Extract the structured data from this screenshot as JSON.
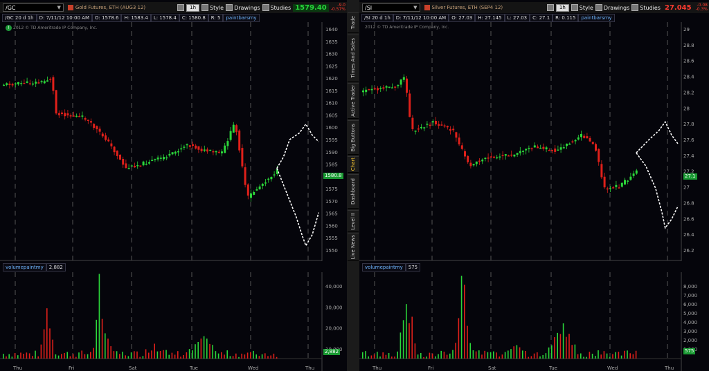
{
  "left": {
    "symbol": "/GC",
    "description": "Gold Futures, ETH (AUG3 12)",
    "timeframe": "1h",
    "style_label": "Style",
    "drawings_label": "Drawings",
    "studies_label": "Studies",
    "last_price": "1579.40",
    "change": [
      "-9.0",
      "-0.57%"
    ],
    "ohlc": [
      "/GC 20 d 1h",
      "D: 7/11/12 10:00 AM",
      "O: 1578.6",
      "H: 1583.4",
      "L: 1578.4",
      "C: 1580.8",
      "R: 5",
      "paintbarsmy"
    ],
    "copyright": "2012 © TD Ameritrade IP Company, Inc.",
    "price_axis": [
      "1640",
      "1635",
      "1630",
      "1625",
      "1620",
      "1615",
      "1610",
      "1605",
      "1600",
      "1595",
      "1590",
      "1585",
      "1580",
      "1575",
      "1570",
      "1565",
      "1560",
      "1555",
      "1550"
    ],
    "current_tag": "1580.8",
    "vol_study": "volumepaintmy",
    "vol_value": "2,882",
    "vol_axis": [
      "40,000",
      "30,000",
      "20,000",
      "10,000"
    ],
    "vol_tag": "2,882",
    "days": [
      "Thu",
      "Fri",
      "Sat",
      "Tue",
      "Wed",
      "Thu"
    ]
  },
  "right": {
    "symbol": "/SI",
    "description": "Silver Futures, ETH (SEP4 12)",
    "timeframe": "1h",
    "style_label": "Style",
    "drawings_label": "Drawings",
    "studies_label": "Studies",
    "last_price": "27.045",
    "change": [
      "-0.08",
      "-0.3%"
    ],
    "ohlc": [
      "/SI 20 d 1h",
      "D: 7/11/12 10:00 AM",
      "O: 27.03",
      "H: 27.145",
      "L: 27.03",
      "C: 27.1",
      "R: 0.115",
      "paintbarsmy"
    ],
    "copyright": "2012 © TD Ameritrade IP Company, Inc.",
    "price_axis": [
      "29",
      "28.8",
      "28.6",
      "28.4",
      "28.2",
      "28",
      "27.8",
      "27.6",
      "27.4",
      "27.2",
      "27",
      "26.8",
      "26.6",
      "26.4",
      "26.2"
    ],
    "current_tag": "27.1",
    "vol_study": "volumepaintmy",
    "vol_value": "575",
    "vol_axis": [
      "8,000",
      "7,000",
      "6,000",
      "5,000",
      "4,000",
      "3,000",
      "2,000",
      "1,000"
    ],
    "vol_tag": "575",
    "days": [
      "Thu",
      "Fri",
      "Sat",
      "Tue",
      "Wed",
      "Thu"
    ]
  },
  "side_tabs": [
    "Trade",
    "Times And Sales",
    "Active Trader",
    "Big Buttons",
    "Chart",
    "Dashboard",
    "Level II",
    "Live News"
  ],
  "active_tab": "Chart",
  "colors": {
    "up": "#2bd63a",
    "down": "#e0201a",
    "background": "#05050b",
    "grid": "#555555",
    "projection": "#ffffff"
  }
}
